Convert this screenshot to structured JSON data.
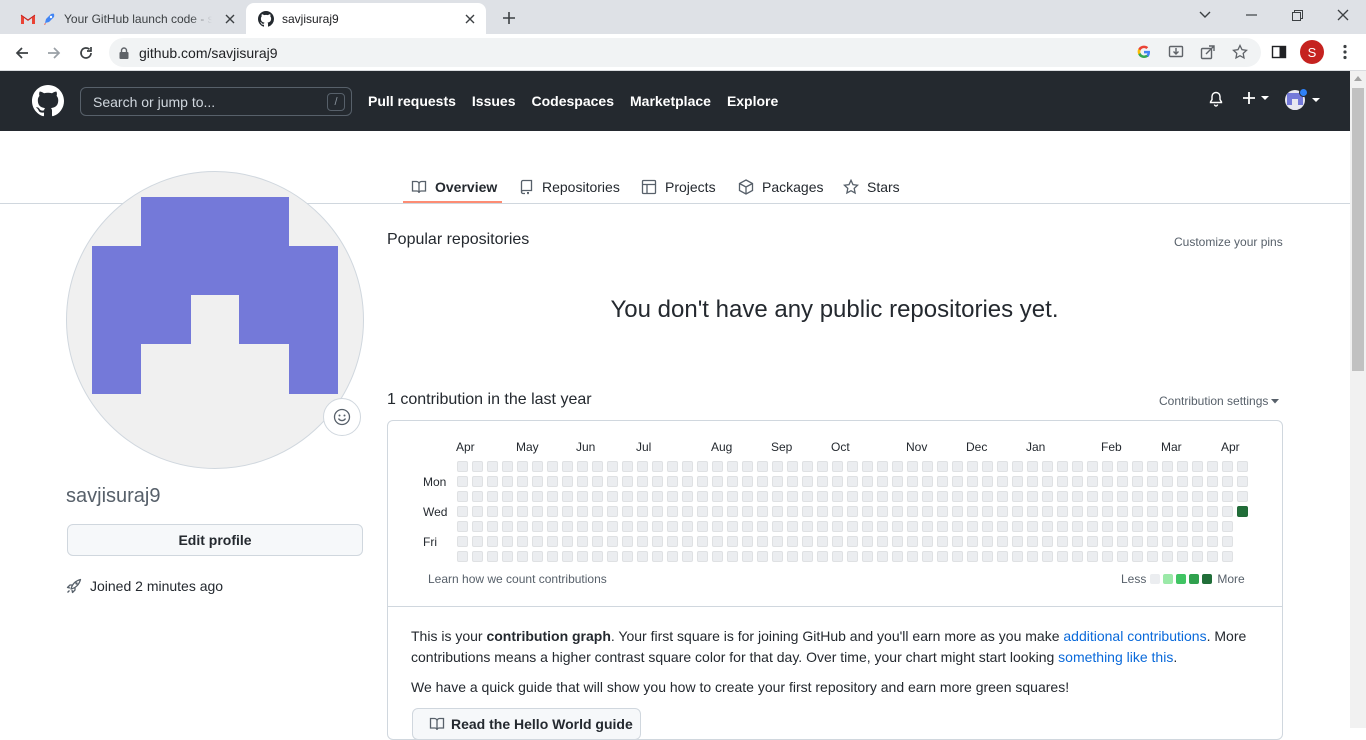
{
  "browser": {
    "tabs": [
      {
        "title": "Your GitHub launch code - sa",
        "favicons": [
          "gmail-icon",
          "rocket-icon"
        ]
      },
      {
        "title": "savjisuraj9",
        "favicon": "github-icon"
      }
    ],
    "url": "github.com/savjisuraj9",
    "profile_initial": "S"
  },
  "gh_header": {
    "search_placeholder": "Search or jump to...",
    "search_shortcut": "/",
    "nav": [
      "Pull requests",
      "Issues",
      "Codespaces",
      "Marketplace",
      "Explore"
    ]
  },
  "profile_tabs": {
    "overview": "Overview",
    "repositories": "Repositories",
    "projects": "Projects",
    "packages": "Packages",
    "stars": "Stars"
  },
  "profile": {
    "username": "savjisuraj9",
    "edit_label": "Edit profile",
    "joined": "Joined 2 minutes ago",
    "avatar_color": "#7479d9"
  },
  "popular": {
    "title": "Popular repositories",
    "customize": "Customize your pins",
    "empty": "You don't have any public repositories yet."
  },
  "contributions": {
    "title": "1 contribution in the last year",
    "settings": "Contribution settings",
    "months": [
      "Apr",
      "May",
      "Jun",
      "Jul",
      "Aug",
      "Sep",
      "Oct",
      "Nov",
      "Dec",
      "Jan",
      "Feb",
      "Mar",
      "Apr"
    ],
    "days": [
      "Mon",
      "Wed",
      "Fri"
    ],
    "learn": "Learn how we count contributions",
    "legend_less": "Less",
    "legend_more": "More",
    "levels": [
      "#ebedf0",
      "#9be9a8",
      "#40c463",
      "#30a14e",
      "#216e39"
    ],
    "weeks": 53,
    "filled_cell": {
      "week": 53,
      "day": 3,
      "level": 4
    },
    "last_week_days": 4
  },
  "explain": {
    "p1_a": "This is your ",
    "p1_b": "contribution graph",
    "p1_c": ". Your first square is for joining GitHub and you'll earn more as you make ",
    "p1_link1": "additional contributions",
    "p1_d": ". More contributions means a higher contrast square color for that day. Over time, your chart might start looking ",
    "p1_link2": "something like this",
    "p1_e": ".",
    "p2": "We have a quick guide that will show you how to create your first repository and earn more green squares!",
    "button": "Read the Hello World guide"
  }
}
